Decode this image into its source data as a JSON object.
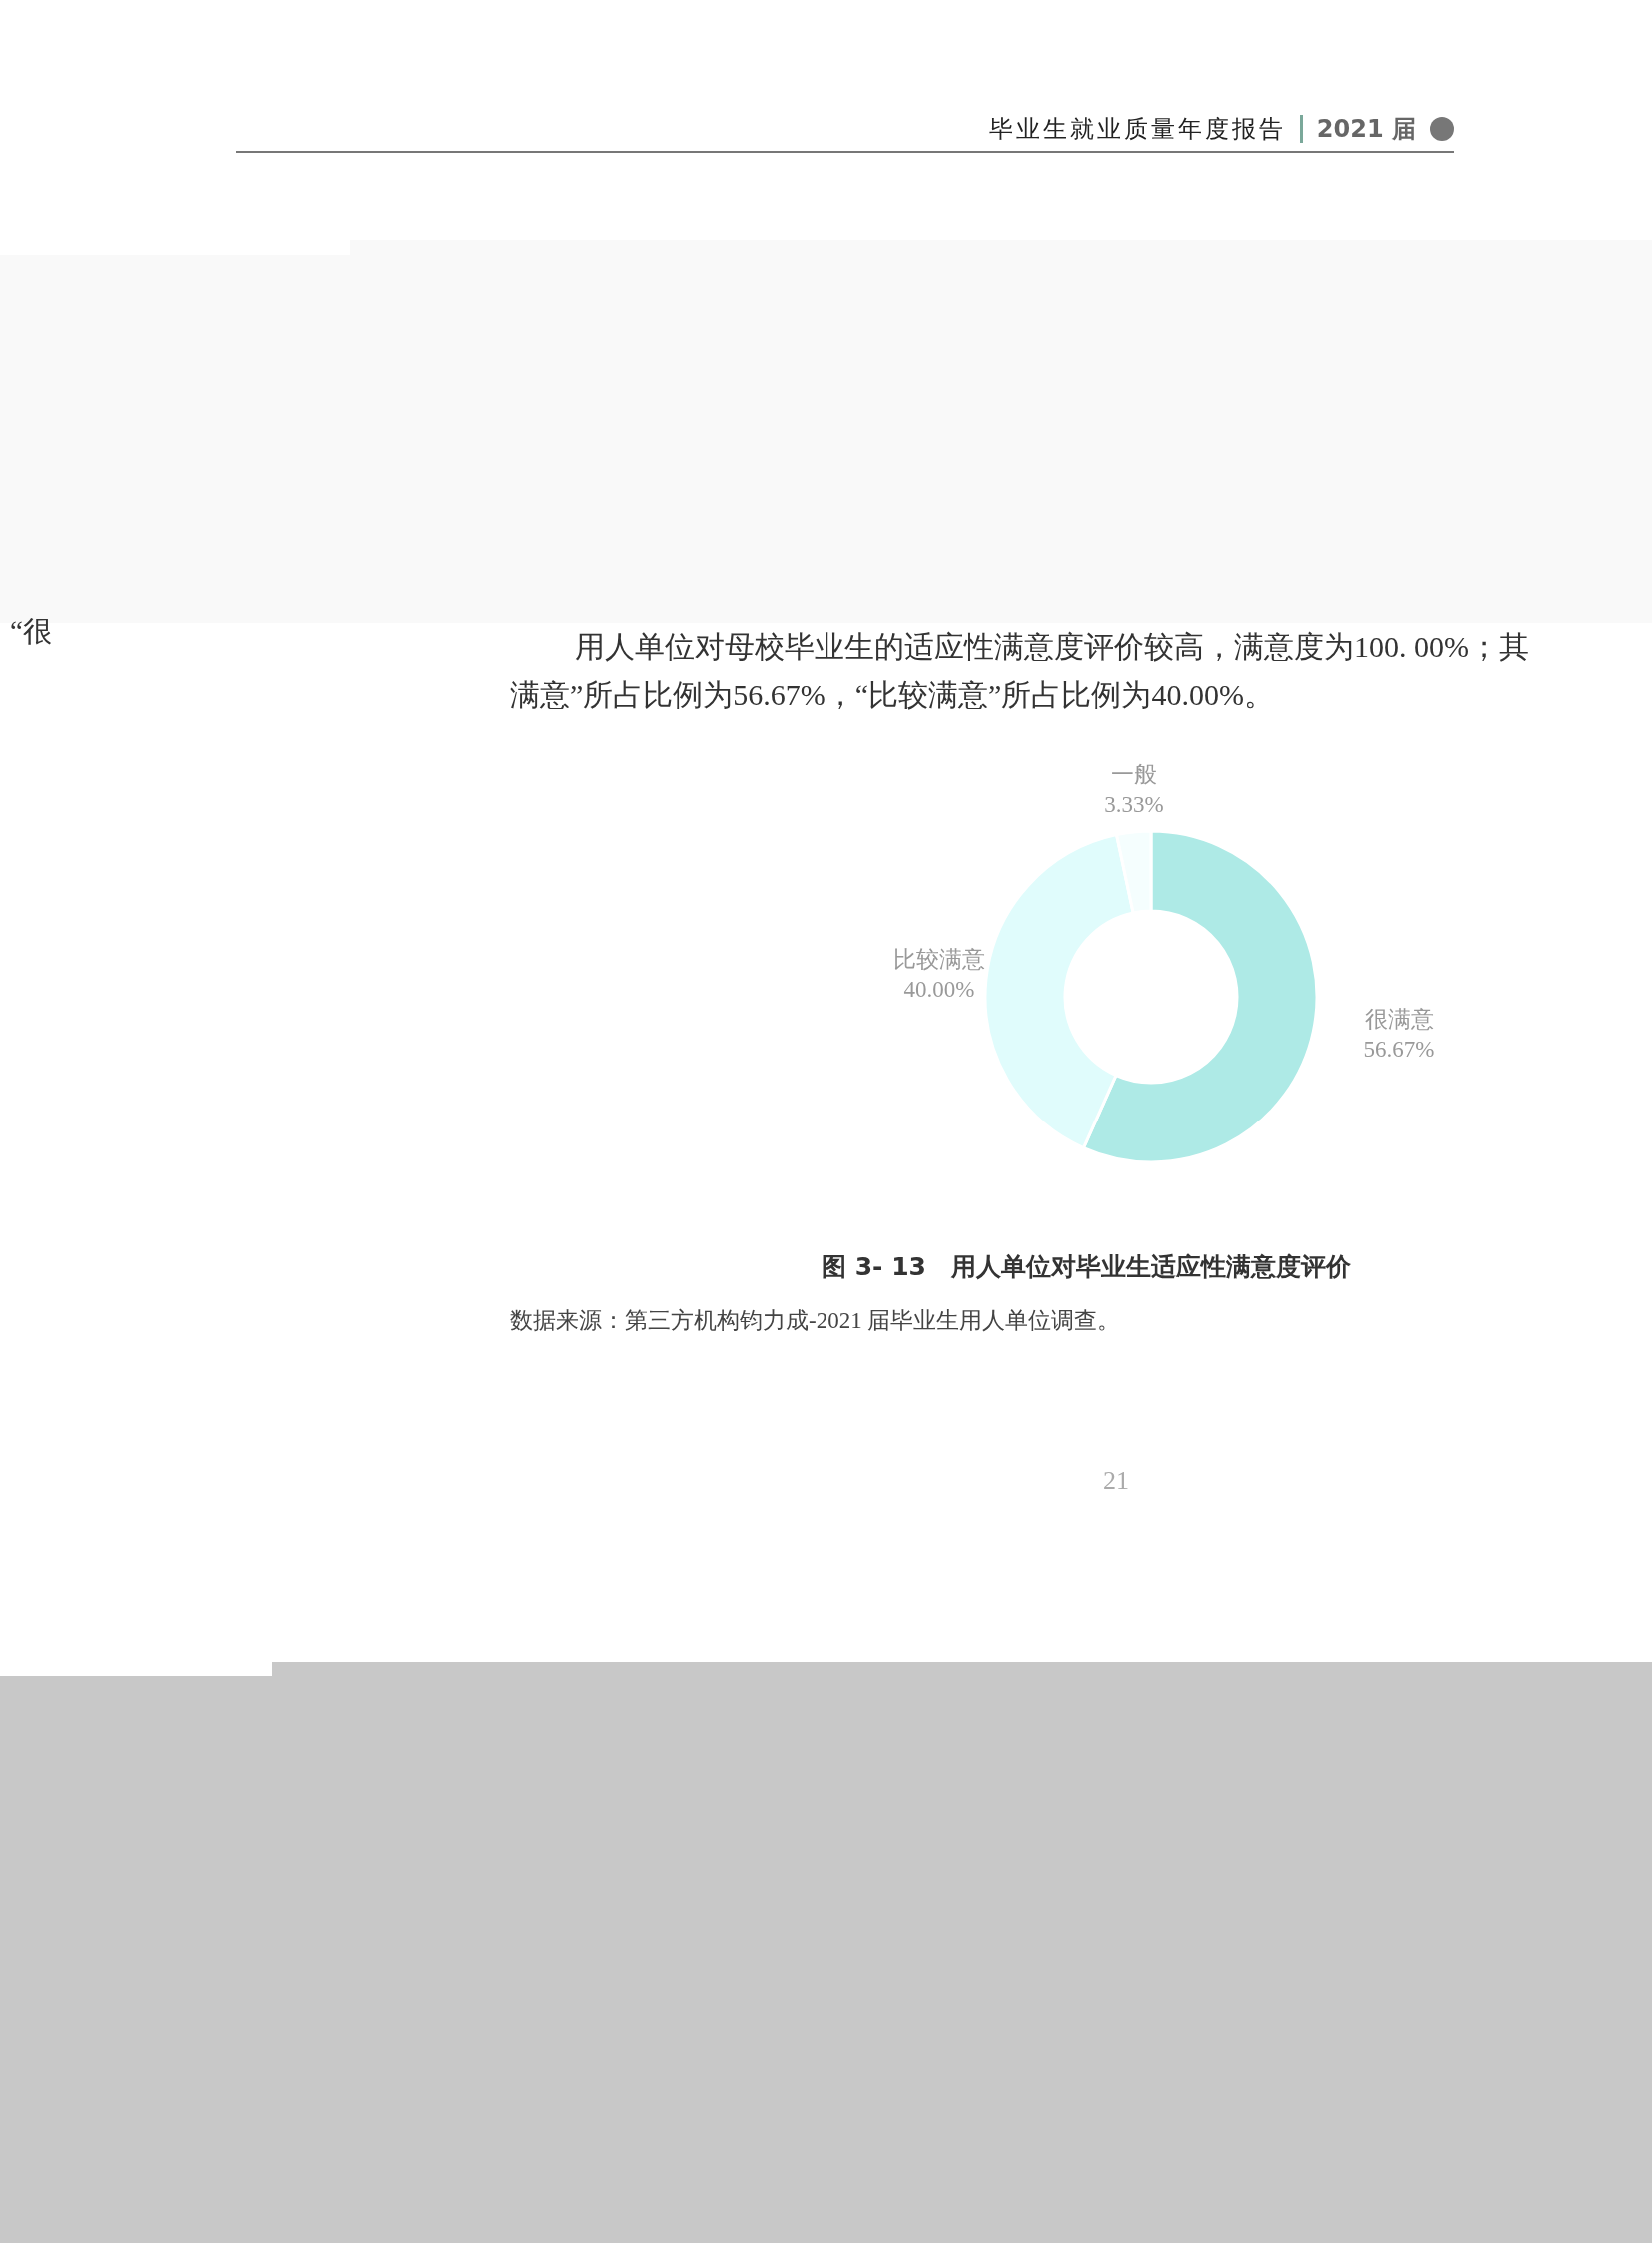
{
  "header": {
    "title": "毕业生就业质量年度报告",
    "edition": "2021 届"
  },
  "margin_text": "“很",
  "paragraph": {
    "line_1": "用人单位对母校毕业生的适应性满意度评价较高，满意度为100. 00%；其",
    "line_2": "满意”所占比例为56.67%，“比较满意”所占比例为40.00%。"
  },
  "chart": {
    "chart_data": {
      "type": "donut",
      "categories": [
        "很满意",
        "比较满意",
        "一般"
      ],
      "values": [
        56.67,
        40.0,
        3.33
      ],
      "value_labels": [
        "56.67%",
        "40.00%",
        "3.33%"
      ]
    }
  },
  "caption": "图 3- 13　用人单位对毕业生适应性满意度评价",
  "source": "数据来源：第三方机构钧力成-2021 届毕业生用人单位调查。",
  "page_number": "21"
}
